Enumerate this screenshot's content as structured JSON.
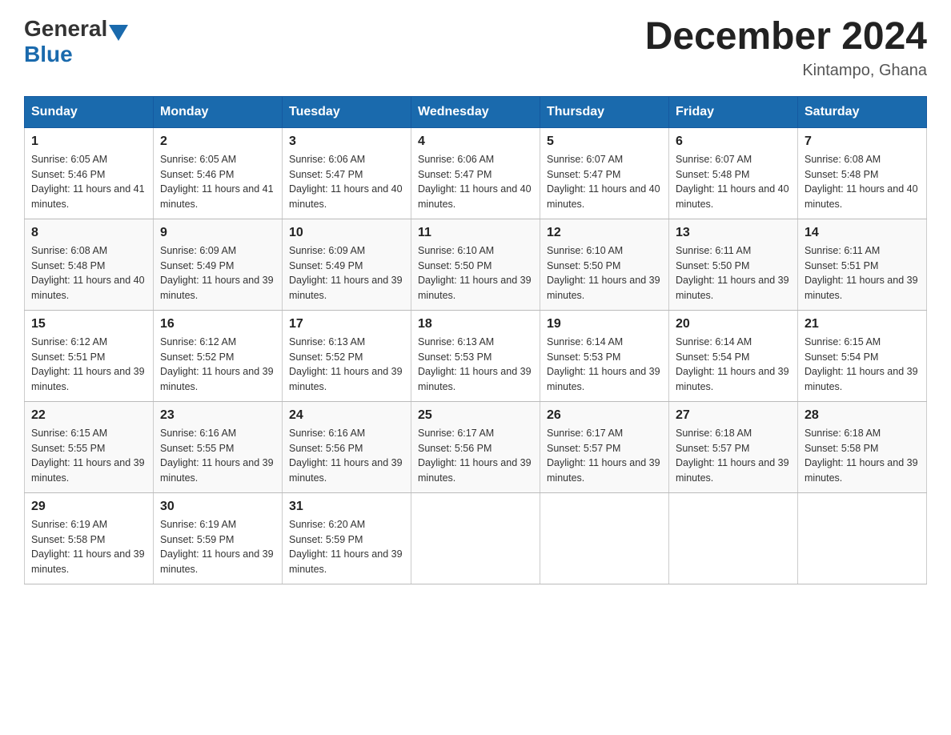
{
  "header": {
    "logo_general": "General",
    "logo_blue": "Blue",
    "title": "December 2024",
    "location": "Kintampo, Ghana"
  },
  "days_of_week": [
    "Sunday",
    "Monday",
    "Tuesday",
    "Wednesday",
    "Thursday",
    "Friday",
    "Saturday"
  ],
  "weeks": [
    [
      {
        "day": "1",
        "sunrise": "6:05 AM",
        "sunset": "5:46 PM",
        "daylight": "11 hours and 41 minutes."
      },
      {
        "day": "2",
        "sunrise": "6:05 AM",
        "sunset": "5:46 PM",
        "daylight": "11 hours and 41 minutes."
      },
      {
        "day": "3",
        "sunrise": "6:06 AM",
        "sunset": "5:47 PM",
        "daylight": "11 hours and 40 minutes."
      },
      {
        "day": "4",
        "sunrise": "6:06 AM",
        "sunset": "5:47 PM",
        "daylight": "11 hours and 40 minutes."
      },
      {
        "day": "5",
        "sunrise": "6:07 AM",
        "sunset": "5:47 PM",
        "daylight": "11 hours and 40 minutes."
      },
      {
        "day": "6",
        "sunrise": "6:07 AM",
        "sunset": "5:48 PM",
        "daylight": "11 hours and 40 minutes."
      },
      {
        "day": "7",
        "sunrise": "6:08 AM",
        "sunset": "5:48 PM",
        "daylight": "11 hours and 40 minutes."
      }
    ],
    [
      {
        "day": "8",
        "sunrise": "6:08 AM",
        "sunset": "5:48 PM",
        "daylight": "11 hours and 40 minutes."
      },
      {
        "day": "9",
        "sunrise": "6:09 AM",
        "sunset": "5:49 PM",
        "daylight": "11 hours and 39 minutes."
      },
      {
        "day": "10",
        "sunrise": "6:09 AM",
        "sunset": "5:49 PM",
        "daylight": "11 hours and 39 minutes."
      },
      {
        "day": "11",
        "sunrise": "6:10 AM",
        "sunset": "5:50 PM",
        "daylight": "11 hours and 39 minutes."
      },
      {
        "day": "12",
        "sunrise": "6:10 AM",
        "sunset": "5:50 PM",
        "daylight": "11 hours and 39 minutes."
      },
      {
        "day": "13",
        "sunrise": "6:11 AM",
        "sunset": "5:50 PM",
        "daylight": "11 hours and 39 minutes."
      },
      {
        "day": "14",
        "sunrise": "6:11 AM",
        "sunset": "5:51 PM",
        "daylight": "11 hours and 39 minutes."
      }
    ],
    [
      {
        "day": "15",
        "sunrise": "6:12 AM",
        "sunset": "5:51 PM",
        "daylight": "11 hours and 39 minutes."
      },
      {
        "day": "16",
        "sunrise": "6:12 AM",
        "sunset": "5:52 PM",
        "daylight": "11 hours and 39 minutes."
      },
      {
        "day": "17",
        "sunrise": "6:13 AM",
        "sunset": "5:52 PM",
        "daylight": "11 hours and 39 minutes."
      },
      {
        "day": "18",
        "sunrise": "6:13 AM",
        "sunset": "5:53 PM",
        "daylight": "11 hours and 39 minutes."
      },
      {
        "day": "19",
        "sunrise": "6:14 AM",
        "sunset": "5:53 PM",
        "daylight": "11 hours and 39 minutes."
      },
      {
        "day": "20",
        "sunrise": "6:14 AM",
        "sunset": "5:54 PM",
        "daylight": "11 hours and 39 minutes."
      },
      {
        "day": "21",
        "sunrise": "6:15 AM",
        "sunset": "5:54 PM",
        "daylight": "11 hours and 39 minutes."
      }
    ],
    [
      {
        "day": "22",
        "sunrise": "6:15 AM",
        "sunset": "5:55 PM",
        "daylight": "11 hours and 39 minutes."
      },
      {
        "day": "23",
        "sunrise": "6:16 AM",
        "sunset": "5:55 PM",
        "daylight": "11 hours and 39 minutes."
      },
      {
        "day": "24",
        "sunrise": "6:16 AM",
        "sunset": "5:56 PM",
        "daylight": "11 hours and 39 minutes."
      },
      {
        "day": "25",
        "sunrise": "6:17 AM",
        "sunset": "5:56 PM",
        "daylight": "11 hours and 39 minutes."
      },
      {
        "day": "26",
        "sunrise": "6:17 AM",
        "sunset": "5:57 PM",
        "daylight": "11 hours and 39 minutes."
      },
      {
        "day": "27",
        "sunrise": "6:18 AM",
        "sunset": "5:57 PM",
        "daylight": "11 hours and 39 minutes."
      },
      {
        "day": "28",
        "sunrise": "6:18 AM",
        "sunset": "5:58 PM",
        "daylight": "11 hours and 39 minutes."
      }
    ],
    [
      {
        "day": "29",
        "sunrise": "6:19 AM",
        "sunset": "5:58 PM",
        "daylight": "11 hours and 39 minutes."
      },
      {
        "day": "30",
        "sunrise": "6:19 AM",
        "sunset": "5:59 PM",
        "daylight": "11 hours and 39 minutes."
      },
      {
        "day": "31",
        "sunrise": "6:20 AM",
        "sunset": "5:59 PM",
        "daylight": "11 hours and 39 minutes."
      },
      null,
      null,
      null,
      null
    ]
  ],
  "labels": {
    "sunrise_prefix": "Sunrise: ",
    "sunset_prefix": "Sunset: ",
    "daylight_prefix": "Daylight: "
  }
}
